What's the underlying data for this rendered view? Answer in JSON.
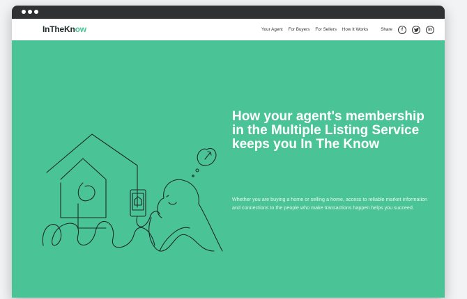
{
  "browser": {
    "dots": 3
  },
  "header": {
    "logo_main": "InTheKn",
    "logo_accent": "ow",
    "nav": [
      {
        "label": "Your Agent"
      },
      {
        "label": "For Buyers"
      },
      {
        "label": "For Sellers"
      },
      {
        "label": "How It Works"
      }
    ],
    "share_label": "Share",
    "social": [
      {
        "icon": "facebook-icon",
        "glyph": "f"
      },
      {
        "icon": "twitter-icon",
        "glyph": "t"
      },
      {
        "icon": "linkedin-icon",
        "glyph": "in"
      }
    ]
  },
  "hero": {
    "headline": "How your agent's membership in the Multiple Listing Service keeps you In The Know",
    "body": "Whether you are buying a home or selling a home, access to reliable market information and connections to the people who make transactions happen helps you succeed."
  },
  "colors": {
    "brand_green": "#4ac496",
    "titlebar": "#2f3133",
    "ink": "#1e2a2a"
  }
}
